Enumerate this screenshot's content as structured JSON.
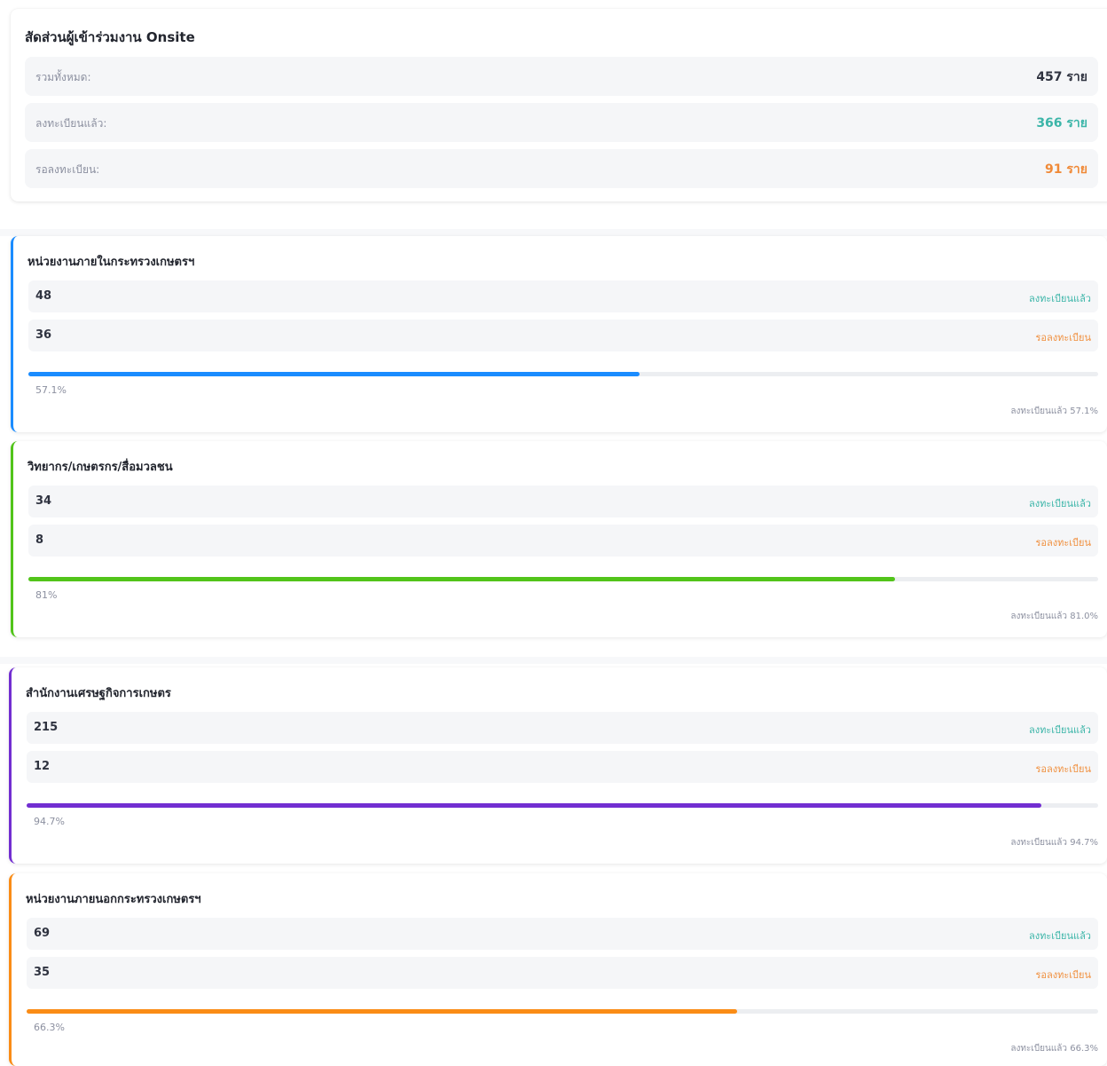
{
  "summary": {
    "title": "สัดส่วนผู้เข้าร่วมงาน Onsite",
    "rows": [
      {
        "label": "รวมทั้งหมด:",
        "value": "457 ราย",
        "color": "#2f3340"
      },
      {
        "label": "ลงทะเบียนแล้ว:",
        "value": "366 ราย",
        "color": "#3bb5a8"
      },
      {
        "label": "รอลงทะเบียน:",
        "value": "91 ราย",
        "color": "#f08a38"
      }
    ]
  },
  "labels": {
    "registered": "ลงทะเบียนแล้ว",
    "pending": "รอลงทะเบียน"
  },
  "colors": {
    "registered": "#3bb5a8",
    "pending": "#f0903f"
  },
  "groups": [
    {
      "title": "หน่วยงานภายในกระทรวงเกษตรฯ",
      "registered": "48",
      "pending": "36",
      "progress": 57.1,
      "percent_label": "57.1%",
      "footer": "ลงทะเบียนแล้ว 57.1%",
      "color": "#1a8cff"
    },
    {
      "title": "วิทยากร/เกษตรกร/สื่อมวลชน",
      "registered": "34",
      "pending": "8",
      "progress": 81.0,
      "percent_label": "81%",
      "footer": "ลงทะเบียนแล้ว 81.0%",
      "color": "#52c41a"
    },
    {
      "title": "สำนักงานเศรษฐกิจการเกษตร",
      "registered": "215",
      "pending": "12",
      "progress": 94.7,
      "percent_label": "94.7%",
      "footer": "ลงทะเบียนแล้ว 94.7%",
      "color": "#722ed1"
    },
    {
      "title": "หน่วยงานภายนอกกระทรวงเกษตรฯ",
      "registered": "69",
      "pending": "35",
      "progress": 66.3,
      "percent_label": "66.3%",
      "footer": "ลงทะเบียนแล้ว 66.3%",
      "color": "#fa8c16"
    }
  ]
}
